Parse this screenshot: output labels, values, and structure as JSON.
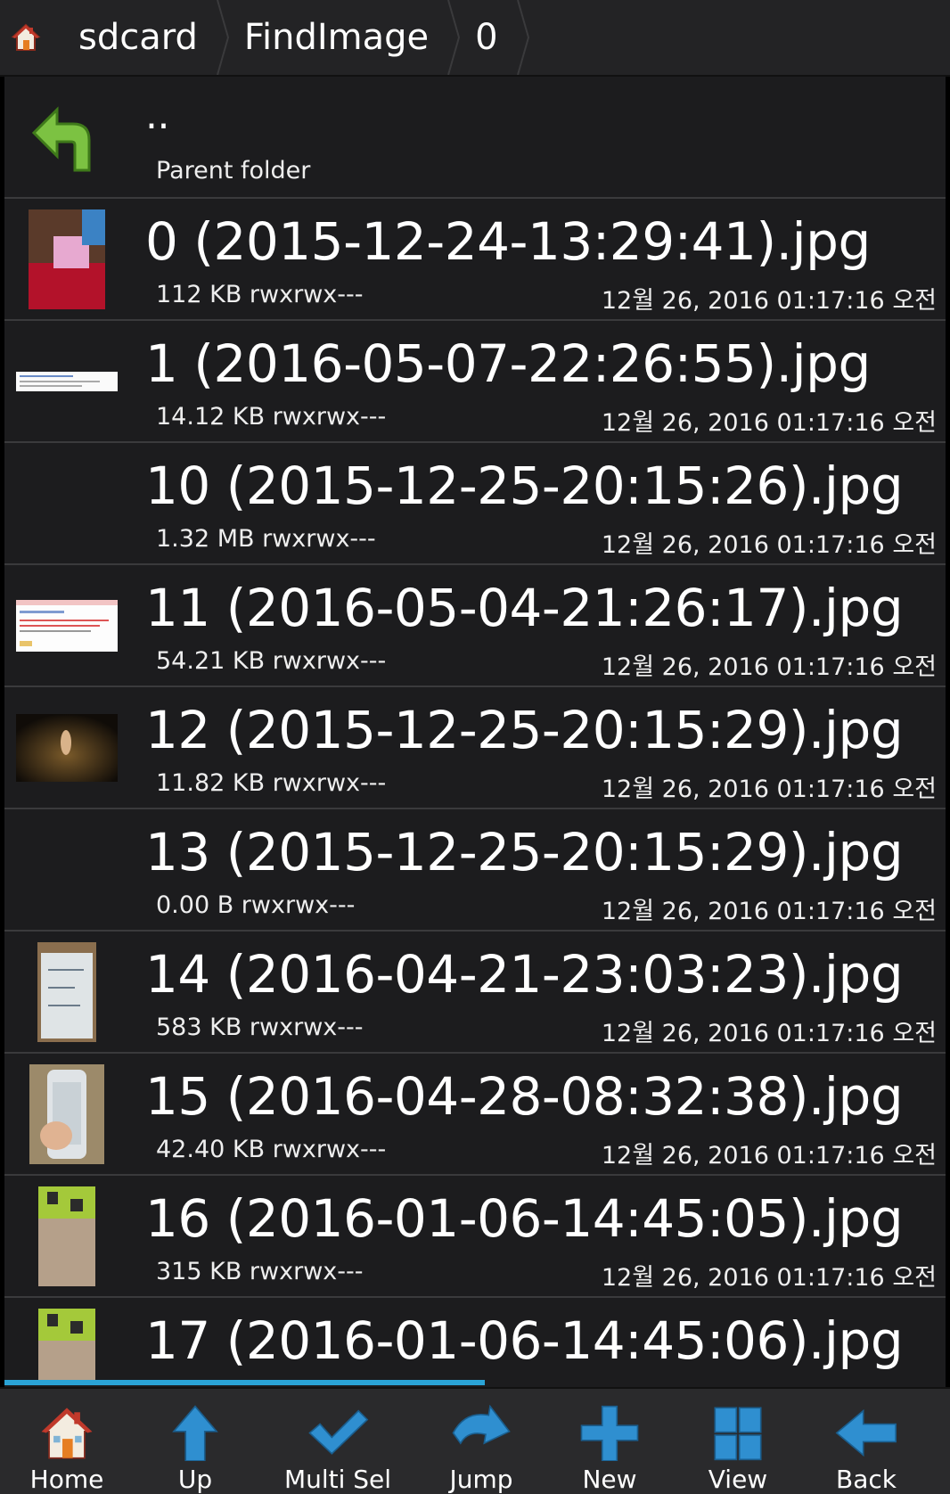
{
  "breadcrumb": {
    "items": [
      "sdcard",
      "FindImage",
      "0"
    ]
  },
  "parent": {
    "name": "..",
    "label": "Parent folder"
  },
  "files": [
    {
      "name": "0 (2015-12-24-13:29:41).jpg",
      "meta": "112 KB rwxrwx---",
      "date": "12월 26, 2016 01:17:16 오전"
    },
    {
      "name": "1 (2016-05-07-22:26:55).jpg",
      "meta": "14.12 KB rwxrwx---",
      "date": "12월 26, 2016 01:17:16 오전"
    },
    {
      "name": "10 (2015-12-25-20:15:26).jpg",
      "meta": "1.32 MB rwxrwx---",
      "date": "12월 26, 2016 01:17:16 오전"
    },
    {
      "name": "11 (2016-05-04-21:26:17).jpg",
      "meta": "54.21 KB rwxrwx---",
      "date": "12월 26, 2016 01:17:16 오전"
    },
    {
      "name": "12 (2015-12-25-20:15:29).jpg",
      "meta": "11.82 KB rwxrwx---",
      "date": "12월 26, 2016 01:17:16 오전"
    },
    {
      "name": "13 (2015-12-25-20:15:29).jpg",
      "meta": "0.00 B rwxrwx---",
      "date": "12월 26, 2016 01:17:16 오전"
    },
    {
      "name": "14 (2016-04-21-23:03:23).jpg",
      "meta": "583 KB rwxrwx---",
      "date": "12월 26, 2016 01:17:16 오전"
    },
    {
      "name": "15 (2016-04-28-08:32:38).jpg",
      "meta": "42.40 KB rwxrwx---",
      "date": "12월 26, 2016 01:17:16 오전"
    },
    {
      "name": "16 (2016-01-06-14:45:05).jpg",
      "meta": "315 KB rwxrwx---",
      "date": "12월 26, 2016 01:17:16 오전"
    },
    {
      "name": "17 (2016-01-06-14:45:06).jpg",
      "meta": "",
      "date": ""
    }
  ],
  "toolbar": {
    "home": "Home",
    "up": "Up",
    "multi_sel": "Multi Sel",
    "jump": "Jump",
    "new": "New",
    "view": "View",
    "back": "Back"
  },
  "colors": {
    "accent": "#2aa3d6",
    "background": "#1c1c1e",
    "divider": "#3a3a3c"
  },
  "scroll_progress": 0.51
}
